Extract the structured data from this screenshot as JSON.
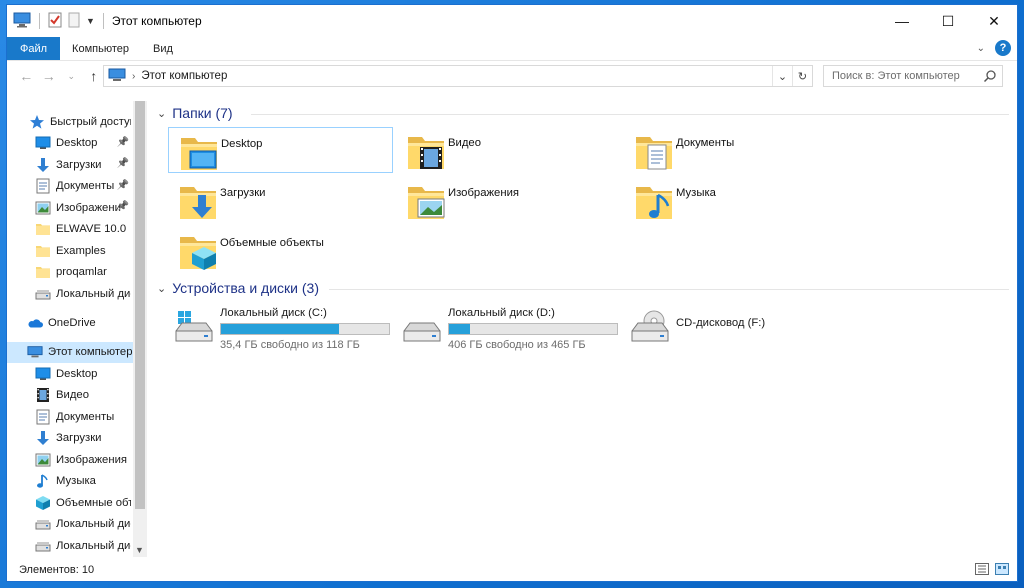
{
  "window": {
    "title": "Этот компьютер",
    "controls": {
      "minimize": "—",
      "maximize": "☐",
      "close": "✕"
    }
  },
  "ribbon": {
    "tabs": [
      "Файл",
      "Компьютер",
      "Вид"
    ],
    "help": "?"
  },
  "address": {
    "path": "Этот компьютер",
    "search_placeholder": "Поиск в: Этот компьютер"
  },
  "nav": {
    "quick_access": "Быстрый доступ",
    "quick_items": [
      {
        "label": "Desktop",
        "icon": "desktop-icon",
        "pinned": true
      },
      {
        "label": "Загрузки",
        "icon": "downloads-icon",
        "pinned": true
      },
      {
        "label": "Документы",
        "icon": "documents-icon",
        "pinned": true
      },
      {
        "label": "Изображени",
        "icon": "pictures-icon",
        "pinned": true
      },
      {
        "label": "ELWAVE 10.0",
        "icon": "folder-icon",
        "pinned": false
      },
      {
        "label": "Examples",
        "icon": "folder-icon",
        "pinned": false
      },
      {
        "label": "proqamlar",
        "icon": "folder-icon",
        "pinned": false
      },
      {
        "label": "Локальный дис",
        "icon": "drive-icon",
        "pinned": false
      }
    ],
    "onedrive": "OneDrive",
    "this_pc": "Этот компьютер",
    "pc_items": [
      {
        "label": "Desktop",
        "icon": "desktop-icon"
      },
      {
        "label": "Видео",
        "icon": "video-icon"
      },
      {
        "label": "Документы",
        "icon": "documents-icon"
      },
      {
        "label": "Загрузки",
        "icon": "downloads-icon"
      },
      {
        "label": "Изображения",
        "icon": "pictures-icon"
      },
      {
        "label": "Музыка",
        "icon": "music-icon"
      },
      {
        "label": "Объемные объ",
        "icon": "3d-objects-icon"
      },
      {
        "label": "Локальный дис",
        "icon": "drive-icon"
      },
      {
        "label": "Локальный дис",
        "icon": "drive-icon"
      }
    ]
  },
  "folders": {
    "header": "Папки (7)",
    "items": [
      {
        "label": "Desktop",
        "icon": "desktop-folder-icon"
      },
      {
        "label": "Видео",
        "icon": "video-folder-icon"
      },
      {
        "label": "Документы",
        "icon": "documents-folder-icon"
      },
      {
        "label": "Загрузки",
        "icon": "downloads-folder-icon"
      },
      {
        "label": "Изображения",
        "icon": "pictures-folder-icon"
      },
      {
        "label": "Музыка",
        "icon": "music-folder-icon"
      },
      {
        "label": "Объемные объекты",
        "icon": "3d-objects-folder-icon"
      }
    ]
  },
  "drives": {
    "header": "Устройства и диски (3)",
    "items": [
      {
        "label": "Локальный диск (C:)",
        "free": "35,4 ГБ свободно из 118 ГБ",
        "used_fraction": 0.7,
        "icon": "windows-drive-icon",
        "show_bar": true
      },
      {
        "label": "Локальный диск (D:)",
        "free": "406 ГБ свободно из 465 ГБ",
        "used_fraction": 0.127,
        "icon": "drive-icon",
        "show_bar": true
      },
      {
        "label": "CD-дисковод (F:)",
        "free": "",
        "used_fraction": 0,
        "icon": "cd-drive-icon",
        "show_bar": false
      }
    ]
  },
  "status": {
    "items_count": "Элементов: 10"
  },
  "colors": {
    "accent": "#1979ca",
    "bar": "#26a0da",
    "selected": "#cce8ff",
    "header": "#1e3287"
  }
}
